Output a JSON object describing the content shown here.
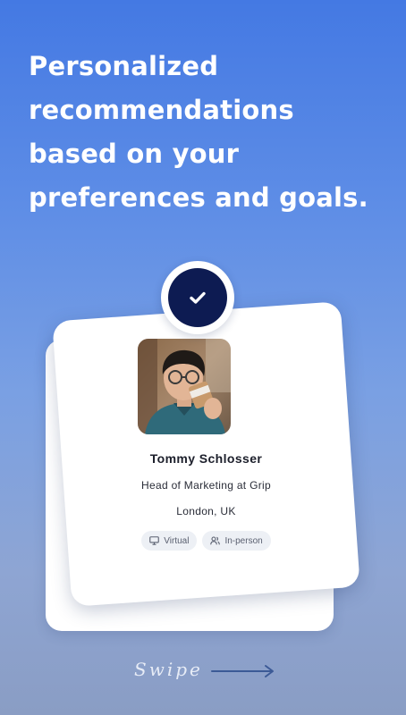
{
  "headline": "Personalized recommendations based on your preferences and goals.",
  "profile": {
    "name": "Tommy Schlosser",
    "title": "Head of Marketing at Grip",
    "location": "London, UK",
    "avatar_icon": "person-photo",
    "tags": [
      {
        "label": "Virtual",
        "icon": "monitor-icon"
      },
      {
        "label": "In-person",
        "icon": "people-icon"
      }
    ]
  },
  "match_badge": {
    "icon": "check-icon",
    "color": "#0d1b52"
  },
  "swipe": {
    "label": "Swipe",
    "icon": "arrow-right-icon"
  },
  "colors": {
    "background_top": "#4479e3",
    "background_bottom": "#8a9dc4",
    "card": "#ffffff",
    "tag_bg": "#edf0f5"
  }
}
